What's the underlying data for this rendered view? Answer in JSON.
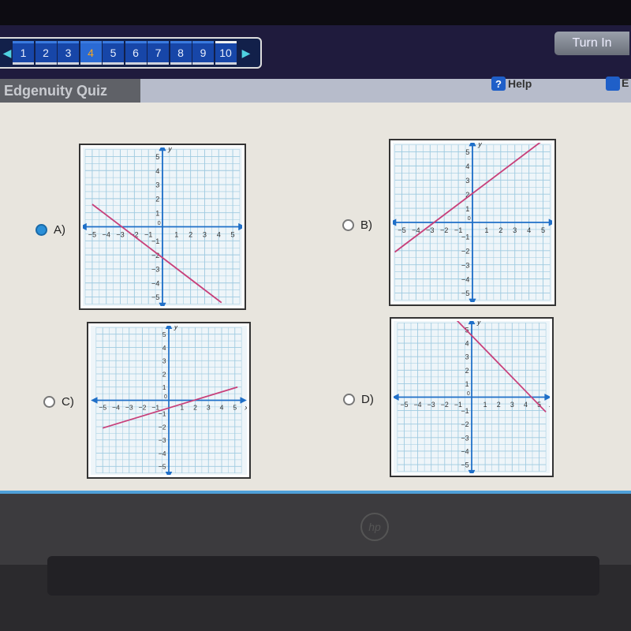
{
  "nav": {
    "questions": [
      "1",
      "2",
      "3",
      "4",
      "5",
      "6",
      "7",
      "8",
      "9",
      "10"
    ],
    "current": "4",
    "prev_icon": "triangle-left-icon",
    "next_icon": "triangle-right-icon",
    "turn_in": "Turn In"
  },
  "header": {
    "title": "Edgenuity Quiz",
    "help": "Help",
    "help_icon": "?",
    "extra": "E"
  },
  "brand": "hp",
  "options": [
    {
      "label": "A)",
      "selected": true,
      "chart": {
        "type": "line",
        "x_range": [
          -5,
          5
        ],
        "y_range": [
          -5,
          5
        ],
        "grid": true,
        "xlabel": "x",
        "ylabel": "y",
        "points": [
          [
            -5,
            1.6
          ],
          [
            4.2,
            -5.4
          ]
        ]
      }
    },
    {
      "label": "B)",
      "selected": false,
      "chart": {
        "type": "line",
        "x_range": [
          -5,
          5
        ],
        "y_range": [
          -5,
          5
        ],
        "grid": true,
        "xlabel": "x",
        "ylabel": "y",
        "points": [
          [
            -5.5,
            -2.1
          ],
          [
            5.1,
            5.9
          ]
        ]
      }
    },
    {
      "label": "C)",
      "selected": false,
      "chart": {
        "type": "line",
        "x_range": [
          -5,
          5
        ],
        "y_range": [
          -5,
          5
        ],
        "grid": true,
        "xlabel": "x",
        "ylabel": "y",
        "points": [
          [
            -5,
            -2.1
          ],
          [
            5.2,
            1.0
          ]
        ]
      }
    },
    {
      "label": "D)",
      "selected": false,
      "chart": {
        "type": "line",
        "x_range": [
          -5,
          5
        ],
        "y_range": [
          -5,
          5
        ],
        "grid": true,
        "xlabel": "x",
        "ylabel": "y",
        "points": [
          [
            -1.2,
            5.8
          ],
          [
            5.5,
            -1.1
          ]
        ]
      }
    }
  ],
  "chart_data": [
    {
      "type": "line",
      "xlabel": "x",
      "ylabel": "y",
      "xlim": [
        -5,
        5
      ],
      "ylim": [
        -5,
        5
      ],
      "x_ticks": [
        -5,
        -4,
        -3,
        -2,
        -1,
        1,
        2,
        3,
        4,
        5
      ],
      "y_ticks": [
        -5,
        -4,
        -3,
        -2,
        -1,
        1,
        2,
        3,
        4,
        5
      ],
      "origin_label": "0",
      "grid": true,
      "points": [
        [
          -5,
          1.6
        ],
        [
          4.2,
          -5.4
        ]
      ],
      "color": "#c8407a"
    },
    {
      "type": "line",
      "xlabel": "x",
      "ylabel": "y",
      "xlim": [
        -5,
        5
      ],
      "ylim": [
        -5,
        5
      ],
      "x_ticks": [
        -5,
        -4,
        -3,
        -2,
        -1,
        1,
        2,
        3,
        4,
        5
      ],
      "y_ticks": [
        -5,
        -4,
        -3,
        -2,
        -1,
        1,
        2,
        3,
        4,
        5
      ],
      "origin_label": "0",
      "grid": true,
      "points": [
        [
          -5.5,
          -2.1
        ],
        [
          5.1,
          5.9
        ]
      ],
      "color": "#c8407a"
    },
    {
      "type": "line",
      "xlabel": "x",
      "ylabel": "y",
      "xlim": [
        -5,
        5
      ],
      "ylim": [
        -5,
        5
      ],
      "x_ticks": [
        -5,
        -4,
        -3,
        -2,
        -1,
        1,
        2,
        3,
        4,
        5
      ],
      "y_ticks": [
        -5,
        -4,
        -3,
        -2,
        -1,
        1,
        2,
        3,
        4,
        5
      ],
      "origin_label": "0",
      "grid": true,
      "points": [
        [
          -5,
          -2.1
        ],
        [
          5.2,
          1.0
        ]
      ],
      "color": "#c8407a"
    },
    {
      "type": "line",
      "xlabel": "x",
      "ylabel": "y",
      "xlim": [
        -5,
        5
      ],
      "ylim": [
        -5,
        5
      ],
      "x_ticks": [
        -5,
        -4,
        -3,
        -2,
        -1,
        1,
        2,
        3,
        4,
        5
      ],
      "y_ticks": [
        -5,
        -4,
        -3,
        -2,
        -1,
        1,
        2,
        3,
        4,
        5
      ],
      "origin_label": "0",
      "grid": true,
      "points": [
        [
          -1.2,
          5.8
        ],
        [
          5.5,
          -1.1
        ]
      ],
      "color": "#c8407a"
    }
  ],
  "colors": {
    "nav_bg": "#1f1b3d",
    "question_button": "#1746a8",
    "current_question": "#f5a623",
    "axis": "#1f6fc8",
    "grid": "#9ecae0",
    "line": "#c8407a",
    "radio_selected": "#2a8fd8"
  }
}
